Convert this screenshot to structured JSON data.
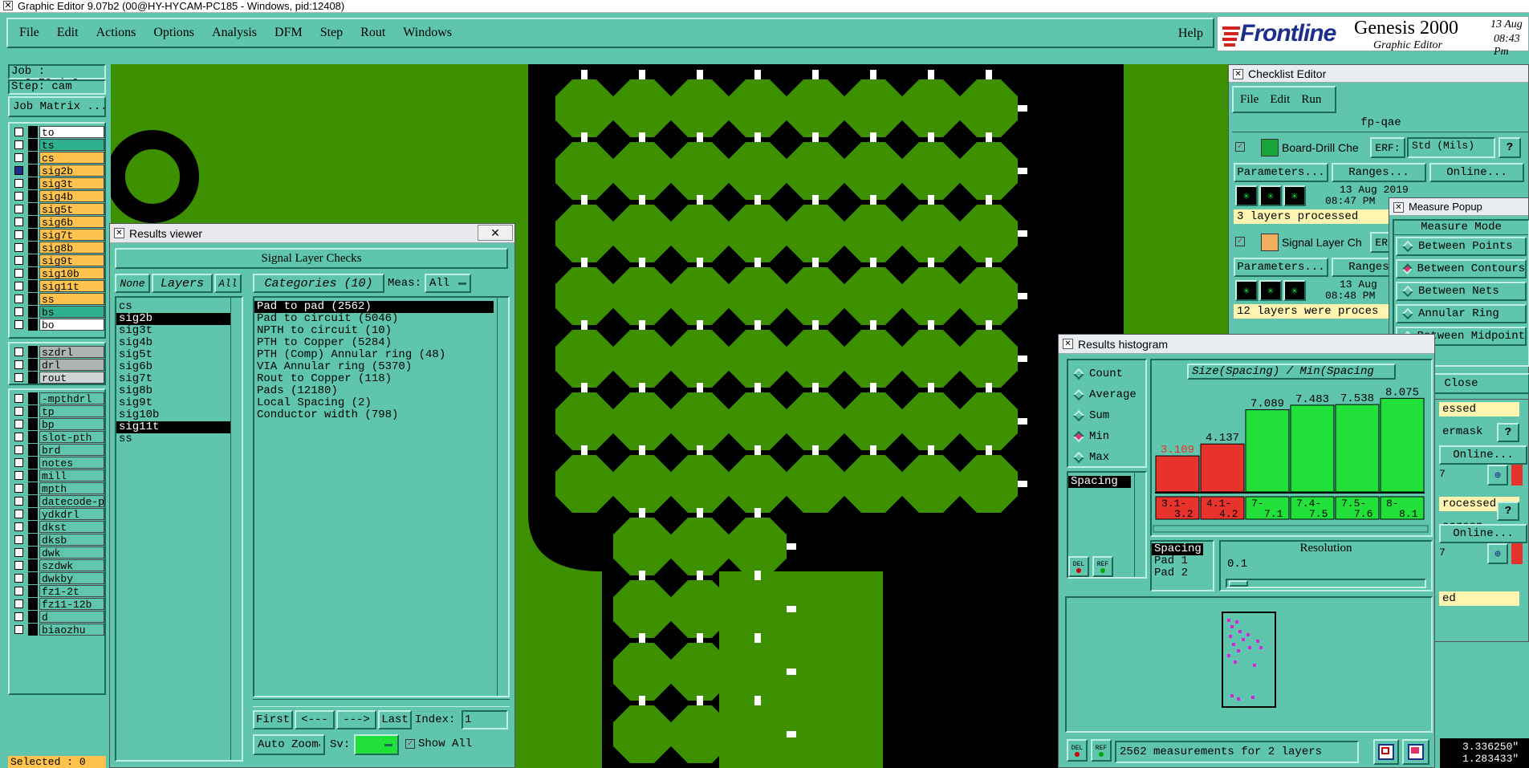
{
  "window": {
    "title": "Graphic Editor 9.07b2 (00@HY-HYCAM-PC185 - Windows, pid:12408)"
  },
  "menubar": {
    "items": [
      "File",
      "Edit",
      "Actions",
      "Options",
      "Analysis",
      "DFM",
      "Step",
      "Rout",
      "Windows"
    ],
    "help": "Help"
  },
  "brand": {
    "logo": "Frontline",
    "product": "Genesis 2000",
    "subtitle": "Graphic Editor",
    "date": "13 Aug",
    "time": "08:43 Pm"
  },
  "job": {
    "job_label": "Job : cv2g70xja0",
    "step_label": "Step: cam",
    "matrix_button": "Job Matrix ..."
  },
  "layers_top": [
    {
      "name": "to",
      "color": "#ffffff"
    },
    {
      "name": "ts",
      "color": "#2fb08f"
    },
    {
      "name": "cs",
      "color": "#ffc34d"
    },
    {
      "name": "sig2b",
      "color": "#ffc34d",
      "active": true
    },
    {
      "name": "sig3t",
      "color": "#ffc34d"
    },
    {
      "name": "sig4b",
      "color": "#ffc34d"
    },
    {
      "name": "sig5t",
      "color": "#ffc34d"
    },
    {
      "name": "sig6b",
      "color": "#ffc34d"
    },
    {
      "name": "sig7t",
      "color": "#ffc34d"
    },
    {
      "name": "sig8b",
      "color": "#ffc34d"
    },
    {
      "name": "sig9t",
      "color": "#ffc34d"
    },
    {
      "name": "sig10b",
      "color": "#ffc34d"
    },
    {
      "name": "sig11t",
      "color": "#ffc34d"
    },
    {
      "name": "ss",
      "color": "#ffc34d"
    },
    {
      "name": "bs",
      "color": "#2fb08f"
    },
    {
      "name": "bo",
      "color": "#ffffff"
    }
  ],
  "layers_drill": [
    {
      "name": "szdrl",
      "color": "#aeb4b4"
    },
    {
      "name": "drl",
      "color": "#aeb4b4"
    },
    {
      "name": "rout",
      "color": "#d0d4d4"
    }
  ],
  "layers_misc": [
    {
      "name": "-mpthdrl"
    },
    {
      "name": "tp"
    },
    {
      "name": "bp"
    },
    {
      "name": "slot-pth"
    },
    {
      "name": "brd"
    },
    {
      "name": "notes"
    },
    {
      "name": "mill"
    },
    {
      "name": "mpth"
    },
    {
      "name": "datecode-pbe"
    },
    {
      "name": "ydkdrl"
    },
    {
      "name": "dkst"
    },
    {
      "name": "dksb"
    },
    {
      "name": "dwk"
    },
    {
      "name": "szdwk"
    },
    {
      "name": "dwkby"
    },
    {
      "name": "fz1-2t"
    },
    {
      "name": "fz11-12b"
    },
    {
      "name": "d"
    },
    {
      "name": "biaozhu"
    }
  ],
  "status": {
    "selected": "Selected : 0",
    "coord_x": "3.336250\"",
    "coord_y": "1.283433\""
  },
  "results_viewer": {
    "title": "Results viewer",
    "header": "Signal Layer Checks",
    "none_btn": "None",
    "layers_btn": "Layers",
    "all_btn": "All",
    "categories_btn": "Categories (10)",
    "meas_label": "Meas:",
    "meas_value": "All",
    "layers": [
      {
        "name": "cs"
      },
      {
        "name": "sig2b",
        "selected": true
      },
      {
        "name": "sig3t"
      },
      {
        "name": "sig4b"
      },
      {
        "name": "sig5t"
      },
      {
        "name": "sig6b"
      },
      {
        "name": "sig7t"
      },
      {
        "name": "sig8b"
      },
      {
        "name": "sig9t"
      },
      {
        "name": "sig10b"
      },
      {
        "name": "sig11t",
        "selected": true
      },
      {
        "name": "ss"
      }
    ],
    "categories": [
      {
        "name": "Pad to pad (2562)",
        "selected": true
      },
      {
        "name": "Pad to circuit (5046)"
      },
      {
        "name": "NPTH to circuit (10)"
      },
      {
        "name": "PTH to Copper (5284)"
      },
      {
        "name": "PTH (Comp) Annular ring (48)"
      },
      {
        "name": "VIA Annular ring (5370)"
      },
      {
        "name": "Rout to Copper (118)"
      },
      {
        "name": "Pads (12180)"
      },
      {
        "name": "Local Spacing (2)"
      },
      {
        "name": "Conductor width (798)"
      }
    ],
    "nav": {
      "first": "First",
      "prev": "<---",
      "next": "--->",
      "last": "Last",
      "index_label": "Index:",
      "index_value": "1"
    },
    "auto_zoom": "Auto Zoom",
    "sv_label": "Sv:",
    "show_all": "Show All"
  },
  "checklist": {
    "title": "Checklist Editor",
    "menu": [
      "File",
      "Edit",
      "Run"
    ],
    "name": "fp-qae",
    "erf_label": "ERF:",
    "erf_value": "Std (Mils)",
    "q": "?",
    "parameters": "Parameters...",
    "ranges": "Ranges...",
    "online": "Online...",
    "checks": [
      {
        "name": "Board-Drill Che",
        "date": "13 Aug 2019",
        "time": "08:47 PM",
        "status": "3 layers processed"
      },
      {
        "name": "Signal Layer Ch",
        "date": "13 Aug",
        "time": "08:48 PM",
        "status": "12 layers were proces"
      }
    ],
    "partial_status_1": "essed",
    "partial_check_3": "ermask",
    "partial_status_3": "rocessed",
    "partial_check_4": "screen",
    "partial_status_4": "ed",
    "partial_num": "7"
  },
  "measure": {
    "title": "Measure Popup",
    "header": "Measure Mode",
    "modes": [
      {
        "name": "Between Points"
      },
      {
        "name": "Between Contours",
        "on": true
      },
      {
        "name": "Between Nets"
      },
      {
        "name": "Annular Ring"
      },
      {
        "name": "Between Midpoint"
      }
    ],
    "close": "Close"
  },
  "histogram": {
    "title": "Results histogram",
    "modes": [
      {
        "name": "Count"
      },
      {
        "name": "Average"
      },
      {
        "name": "Sum"
      },
      {
        "name": "Min",
        "on": true
      },
      {
        "name": "Max"
      }
    ],
    "list": [
      {
        "name": "Spacing",
        "selected": true
      }
    ],
    "sub_list": [
      {
        "name": "Spacing",
        "selected": true
      },
      {
        "name": "Pad 1"
      },
      {
        "name": "Pad 2"
      }
    ],
    "chart_title": "Size(Spacing) / Min(Spacing",
    "resolution_label": "Resolution",
    "resolution_value": "0.1",
    "footer": "2562 measurements for 2 layers",
    "del": "DEL",
    "ref": "REF"
  },
  "chart_data": {
    "type": "bar",
    "title": "Size(Spacing) / Min(Spacing",
    "categories": [
      "3.1-3.2",
      "4.1-4.2",
      "7-7.1",
      "7.4-7.5",
      "7.5-7.6",
      "8-8.1"
    ],
    "category_lines": [
      [
        "3.1-",
        "3.2"
      ],
      [
        "4.1-",
        "4.2"
      ],
      [
        "7-",
        "7.1"
      ],
      [
        "7.4-",
        "7.5"
      ],
      [
        "7.5-",
        "7.6"
      ],
      [
        "8-",
        "8.1"
      ]
    ],
    "values": [
      3.109,
      4.137,
      7.089,
      7.483,
      7.538,
      8.075
    ],
    "value_labels": [
      "3.109",
      "4.137",
      "7.089",
      "7.483",
      "7.538",
      "8.075"
    ],
    "colors": [
      "#e8332d",
      "#e8332d",
      "#22e03a",
      "#22e03a",
      "#22e03a",
      "#22e03a"
    ],
    "ylim": [
      0,
      9
    ]
  }
}
